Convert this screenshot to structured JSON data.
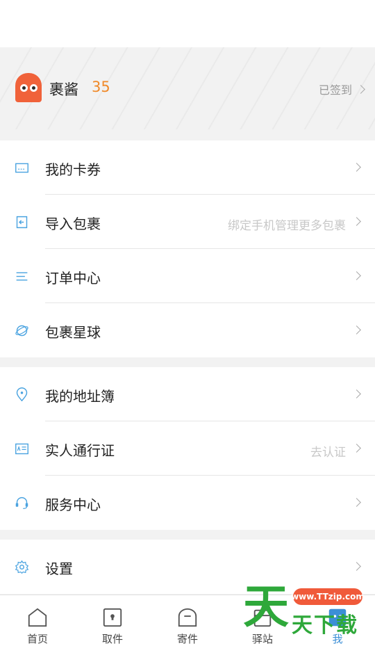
{
  "profile": {
    "username": "裹酱",
    "score": "35",
    "signin_label": "已签到"
  },
  "menu_group_1": [
    {
      "label": "我的卡券",
      "hint": "",
      "icon": "coupon-icon"
    },
    {
      "label": "导入包裹",
      "hint": "绑定手机管理更多包裹",
      "icon": "import-icon"
    },
    {
      "label": "订单中心",
      "hint": "",
      "icon": "list-icon"
    },
    {
      "label": "包裹星球",
      "hint": "",
      "icon": "planet-icon"
    }
  ],
  "menu_group_2": [
    {
      "label": "我的地址簿",
      "hint": "",
      "icon": "location-pin-icon"
    },
    {
      "label": "实人通行证",
      "hint": "去认证",
      "icon": "id-card-icon"
    },
    {
      "label": "服务中心",
      "hint": "",
      "icon": "headset-icon"
    }
  ],
  "menu_group_3": [
    {
      "label": "设置",
      "hint": "",
      "icon": "gear-icon"
    }
  ],
  "tabbar": [
    {
      "label": "首页",
      "icon": "home-icon",
      "active": false
    },
    {
      "label": "取件",
      "icon": "locker-icon",
      "active": false
    },
    {
      "label": "寄件",
      "icon": "mailbox-icon",
      "active": false
    },
    {
      "label": "驿站",
      "icon": "station-icon",
      "active": false
    },
    {
      "label": "我",
      "icon": "profile-icon",
      "active": true
    }
  ],
  "watermark": {
    "big": "天",
    "url": "www.TTzip.com",
    "text": "天下载"
  },
  "colors": {
    "accent": "#4aa3e0",
    "score": "#f08a2a",
    "avatar": "#f0623a",
    "active_tab": "#3c8fd6"
  }
}
